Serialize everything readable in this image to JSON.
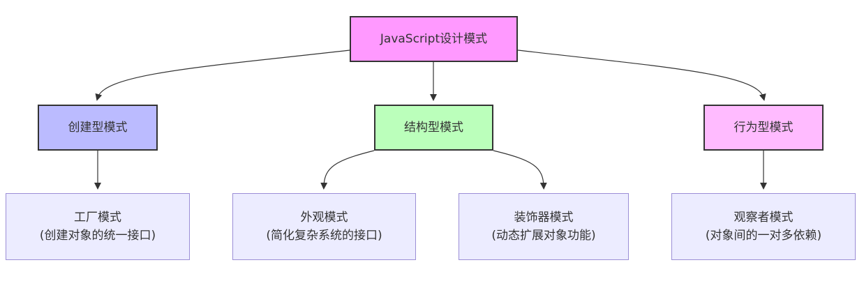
{
  "colors": {
    "root_fill": "#ff99ff",
    "creational_fill": "#bbbbff",
    "structural_fill": "#bbffbb",
    "behavioral_fill": "#ffbbff",
    "leaf_fill": "#ececff",
    "leaf_border": "#9b8ed6",
    "edge": "#333333"
  },
  "root": {
    "label": "JavaScript设计模式"
  },
  "categories": [
    {
      "id": "creational",
      "label": "创建型模式"
    },
    {
      "id": "structural",
      "label": "结构型模式"
    },
    {
      "id": "behavioral",
      "label": "行为型模式"
    }
  ],
  "patterns": [
    {
      "id": "factory",
      "parent": "creational",
      "name": "工厂模式",
      "description": "(创建对象的统一接口)"
    },
    {
      "id": "facade",
      "parent": "structural",
      "name": "外观模式",
      "description": "(简化复杂系统的接口)"
    },
    {
      "id": "decorator",
      "parent": "structural",
      "name": "装饰器模式",
      "description": "(动态扩展对象功能)"
    },
    {
      "id": "observer",
      "parent": "behavioral",
      "name": "观察者模式",
      "description": "(对象间的一对多依赖)"
    }
  ]
}
